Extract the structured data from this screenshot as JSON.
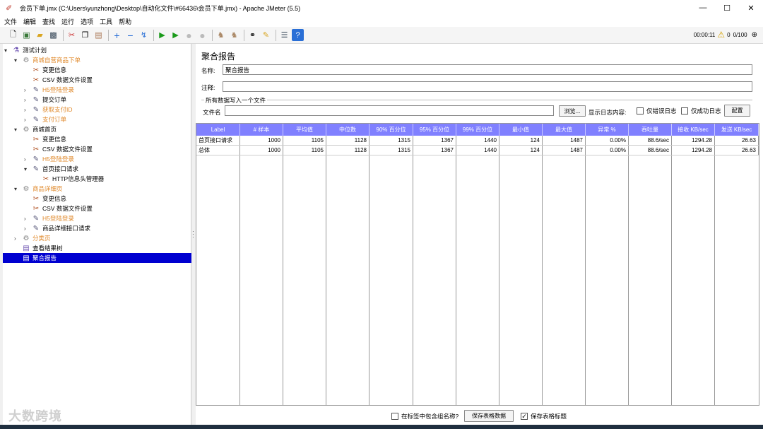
{
  "window": {
    "title": "会员下单.jmx (C:\\Users\\yunzhong\\Desktop\\自动化文件\\#66436\\会员下单.jmx) - Apache JMeter (5.5)",
    "minimize": "—",
    "maximize": "☐",
    "close": "✕"
  },
  "menu": [
    "文件",
    "编辑",
    "查找",
    "运行",
    "选项",
    "工具",
    "帮助"
  ],
  "toolbar": {
    "timer": "00:00:11",
    "warnings": "0",
    "threads": "0/100",
    "colors": {
      "play": "#1a9a1a",
      "add": "#2a6fd6"
    }
  },
  "tree": {
    "items": [
      {
        "label": "测试计划",
        "icon": "flask-icon",
        "glyph": "⚗",
        "disabled": false,
        "arrow": "▾",
        "indent": 0
      },
      {
        "label": "商城自营商品下单",
        "icon": "gear-icon",
        "glyph": "⚙",
        "disabled": true,
        "arrow": "▾",
        "indent": 1
      },
      {
        "label": "变更信息",
        "icon": "scissors-icon",
        "glyph": "✂",
        "disabled": false,
        "arrow": "",
        "indent": 2
      },
      {
        "label": "CSV 数据文件设置",
        "icon": "scissors-icon",
        "glyph": "✂",
        "disabled": false,
        "arrow": "",
        "indent": 2
      },
      {
        "label": "H5登陆登录",
        "icon": "pen-icon",
        "glyph": "✎",
        "disabled": true,
        "arrow": "›",
        "indent": 2
      },
      {
        "label": "提交订单",
        "icon": "pen-icon",
        "glyph": "✎",
        "disabled": false,
        "arrow": "›",
        "indent": 2
      },
      {
        "label": "获取支付ID",
        "icon": "pen-icon",
        "glyph": "✎",
        "disabled": true,
        "arrow": "›",
        "indent": 2
      },
      {
        "label": "支付订单",
        "icon": "pen-icon",
        "glyph": "✎",
        "disabled": true,
        "arrow": "›",
        "indent": 2
      },
      {
        "label": "商城首页",
        "icon": "gear-icon",
        "glyph": "⚙",
        "disabled": false,
        "arrow": "▾",
        "indent": 1
      },
      {
        "label": "变更信息",
        "icon": "scissors-icon",
        "glyph": "✂",
        "disabled": false,
        "arrow": "",
        "indent": 2
      },
      {
        "label": "CSV 数据文件设置",
        "icon": "scissors-icon",
        "glyph": "✂",
        "disabled": false,
        "arrow": "",
        "indent": 2
      },
      {
        "label": "H5登陆登录",
        "icon": "pen-icon",
        "glyph": "✎",
        "disabled": true,
        "arrow": "›",
        "indent": 2
      },
      {
        "label": "首页接口请求",
        "icon": "pen-icon",
        "glyph": "✎",
        "disabled": false,
        "arrow": "▾",
        "indent": 2
      },
      {
        "label": "HTTP信息头管理器",
        "icon": "scissors-icon",
        "glyph": "✂",
        "disabled": false,
        "arrow": "",
        "indent": 3
      },
      {
        "label": "商品详细页",
        "icon": "gear-icon",
        "glyph": "⚙",
        "disabled": true,
        "arrow": "▾",
        "indent": 1
      },
      {
        "label": "变更信息",
        "icon": "scissors-icon",
        "glyph": "✂",
        "disabled": false,
        "arrow": "",
        "indent": 2
      },
      {
        "label": "CSV 数据文件设置",
        "icon": "scissors-icon",
        "glyph": "✂",
        "disabled": false,
        "arrow": "",
        "indent": 2
      },
      {
        "label": "H5登陆登录",
        "icon": "pen-icon",
        "glyph": "✎",
        "disabled": true,
        "arrow": "›",
        "indent": 2
      },
      {
        "label": "商品详细接口请求",
        "icon": "pen-icon",
        "glyph": "✎",
        "disabled": false,
        "arrow": "›",
        "indent": 2
      },
      {
        "label": "分类页",
        "icon": "gear-icon",
        "glyph": "⚙",
        "disabled": true,
        "arrow": "›",
        "indent": 1
      },
      {
        "label": "查看结果树",
        "icon": "chart-icon",
        "glyph": "▤",
        "disabled": false,
        "arrow": "",
        "indent": 1
      },
      {
        "label": "聚合报告",
        "icon": "chart-icon",
        "glyph": "▤",
        "disabled": false,
        "arrow": "",
        "indent": 1,
        "selected": true
      }
    ]
  },
  "panel": {
    "title": "聚合报告",
    "name_label": "名称:",
    "name_value": "聚合报告",
    "comment_label": "注释:",
    "comment_value": "",
    "fieldset_legend": "所有数据写入一个文件",
    "file_label": "文件名",
    "file_value": "",
    "browse": "浏览...",
    "log_label": "显示日志内容:",
    "errors_only": "仅错误日志",
    "success_only": "仅成功日志",
    "config": "配置"
  },
  "table": {
    "headers": [
      "Label",
      "# 样本",
      "平均值",
      "中位数",
      "90% 百分位",
      "95% 百分位",
      "99% 百分位",
      "最小值",
      "最大值",
      "异常 %",
      "吞吐量",
      "接收 KB/sec",
      "发送 KB/sec"
    ],
    "rows": [
      [
        "首页接口请求",
        "1000",
        "1105",
        "1128",
        "1315",
        "1367",
        "1440",
        "124",
        "1487",
        "0.00%",
        "88.6/sec",
        "1294.28",
        "26.63"
      ],
      [
        "总体",
        "1000",
        "1105",
        "1128",
        "1315",
        "1367",
        "1440",
        "124",
        "1487",
        "0.00%",
        "88.6/sec",
        "1294.28",
        "26.63"
      ]
    ]
  },
  "bottom": {
    "include_group": "在标签中包含组名称?",
    "include_group_checked": false,
    "save_data": "保存表格数据",
    "save_header_label": "保存表格标题",
    "save_header_checked": true
  },
  "watermark": "大数跨境"
}
